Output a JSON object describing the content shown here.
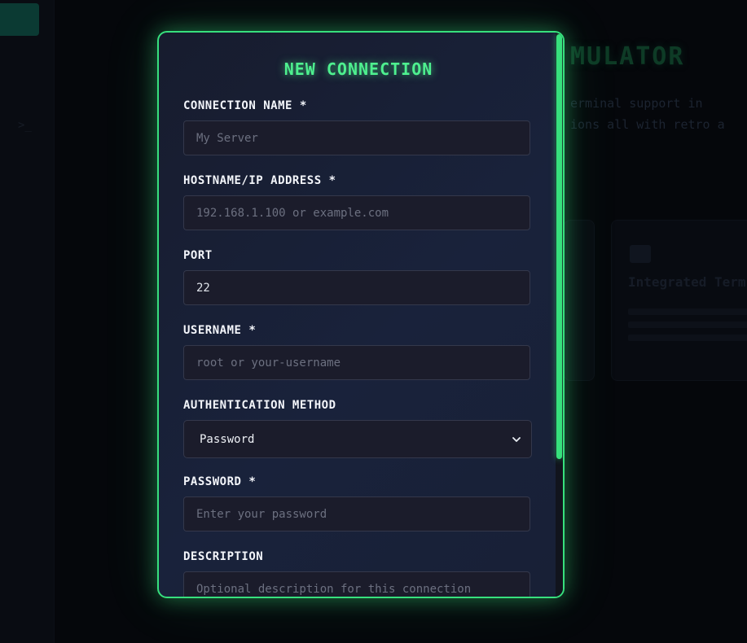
{
  "background": {
    "title": "MULATOR",
    "description_lines": [
      "erminal support in",
      "ions all with retro a"
    ],
    "card_title": "Integrated Term"
  },
  "modal": {
    "title": "NEW CONNECTION",
    "fields": {
      "connection_name": {
        "label": "CONNECTION NAME *",
        "placeholder": "My Server",
        "value": ""
      },
      "hostname": {
        "label": "HOSTNAME/IP ADDRESS *",
        "placeholder": "192.168.1.100 or example.com",
        "value": ""
      },
      "port": {
        "label": "PORT",
        "placeholder": "",
        "value": "22"
      },
      "username": {
        "label": "USERNAME *",
        "placeholder": "root or your-username",
        "value": ""
      },
      "auth_method": {
        "label": "AUTHENTICATION METHOD",
        "selected": "Password"
      },
      "password": {
        "label": "PASSWORD *",
        "placeholder": "Enter your password",
        "value": ""
      },
      "description": {
        "label": "DESCRIPTION",
        "placeholder": "Optional description for this connection",
        "value": ""
      }
    },
    "scroll_position": 0
  },
  "colors": {
    "accent": "#37e07d",
    "title_glow": "#4ef08f",
    "modal_bg": "#19223b",
    "input_bg": "#1b1c2b",
    "page_bg": "#05070b"
  }
}
